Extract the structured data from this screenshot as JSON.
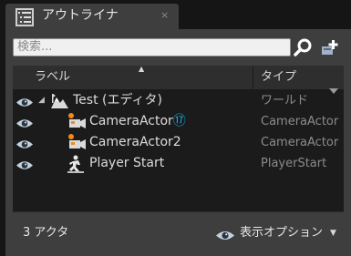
{
  "tab": {
    "title": "アウトライナ",
    "close": "×",
    "icon": "outliner-list-icon"
  },
  "search": {
    "placeholder": "検索...",
    "icon": "search-icon",
    "add_icon": "add-filter-icon"
  },
  "columns": {
    "label": "ラベル",
    "sort_indicator": "▲",
    "type": "タイプ",
    "menu_icon": "column-menu-icon"
  },
  "rows": [
    {
      "name": "Test (エディタ)",
      "badge": "",
      "type": "ワールド",
      "icon": "world-icon",
      "expanded": true
    },
    {
      "name": "CameraActor",
      "badge": "⑰",
      "type": "CameraActor",
      "icon": "camera-actor-icon"
    },
    {
      "name": "CameraActor2",
      "badge": "",
      "type": "CameraActor",
      "icon": "camera-actor-icon"
    },
    {
      "name": "Player Start",
      "badge": "",
      "type": "PlayerStart",
      "icon": "player-start-icon"
    }
  ],
  "footer": {
    "actor_count": "3 アクタ",
    "view_options": "表示オプション",
    "view_options_caret": "▼"
  },
  "colors": {
    "panel_bg": "#3e3e3e",
    "list_bg": "#1b1b1b",
    "accent_badge": "#1aa7ec",
    "eye_icon": "#c4d2de",
    "camera_orange": "#f08a1c"
  }
}
